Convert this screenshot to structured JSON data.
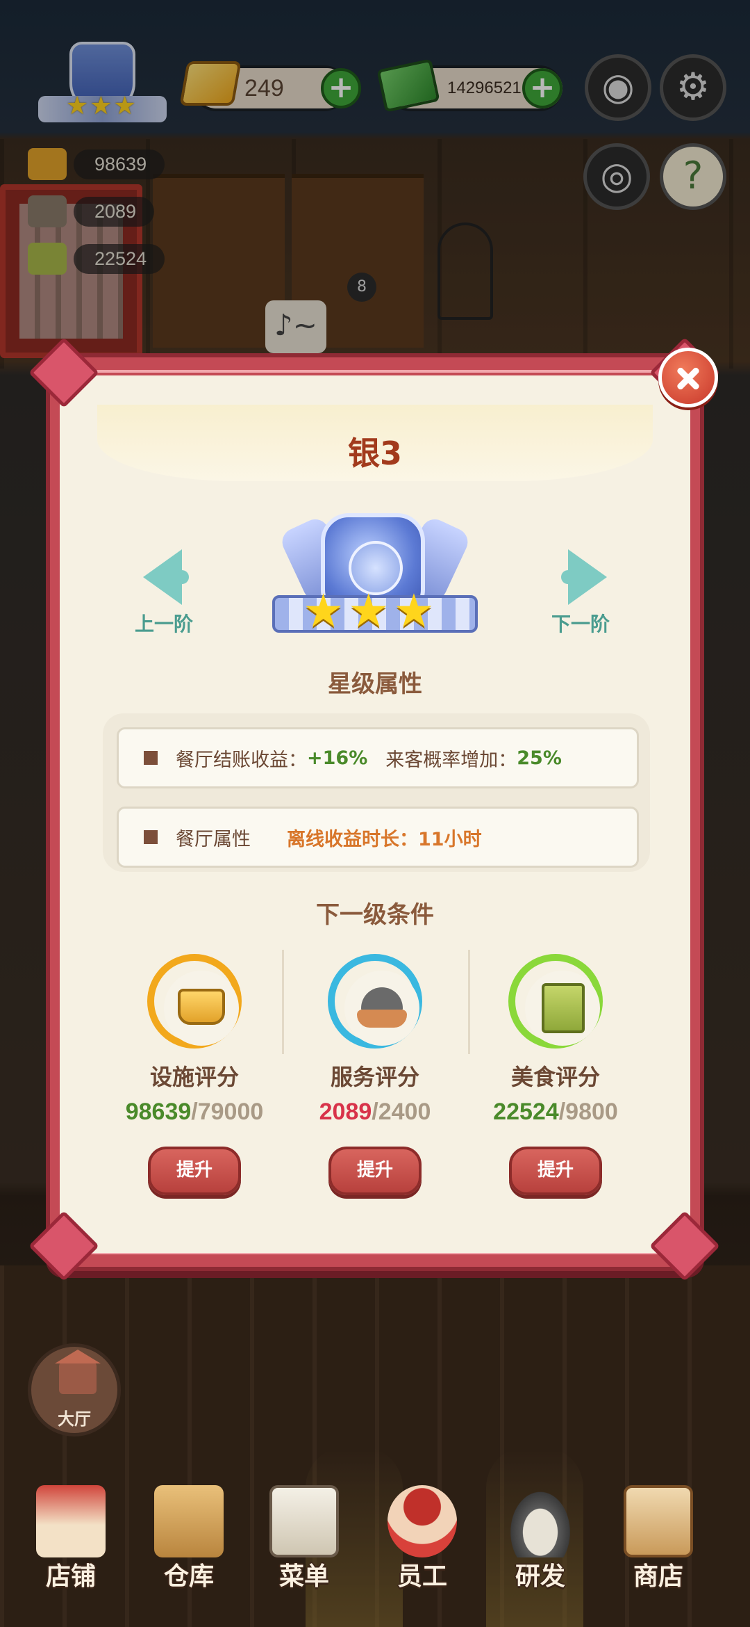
{
  "hud": {
    "rank_stars": "★★★",
    "gold": "249",
    "cash": "14296521",
    "plus": "+",
    "facility_score": "98639",
    "service_score": "2089",
    "food_score": "22524",
    "music_glyph": "♪~",
    "badge_count": "8"
  },
  "modal": {
    "title": "银3",
    "prev_label": "上一阶",
    "next_label": "下一阶",
    "medal_stars": "★★★",
    "attributes_heading": "星级属性",
    "attr1_a_label": "餐厅结账收益：",
    "attr1_a_value": "+16%",
    "attr1_b_label": "来客概率增加：",
    "attr1_b_value": "25%",
    "attr2_label": "餐厅属性",
    "attr2_value": "离线收益时长：11小时",
    "conditions_heading": "下一级条件",
    "conditions": [
      {
        "label": "设施评分",
        "current": "98639",
        "required": "79000",
        "ring_color": "#f2a81c",
        "current_color": "#4a8a2a",
        "button": "提升"
      },
      {
        "label": "服务评分",
        "current": "2089",
        "required": "2400",
        "ring_color": "#3ab8e0",
        "current_color": "#d8334a",
        "button": "提升"
      },
      {
        "label": "美食评分",
        "current": "22524",
        "required": "9800",
        "ring_color": "#8ad83a",
        "current_color": "#4a8a2a",
        "button": "提升"
      }
    ],
    "separator": "/"
  },
  "bottom_nav": {
    "hall": "大厅",
    "items": [
      "店铺",
      "仓库",
      "菜单",
      "员工",
      "研发",
      "商店"
    ]
  },
  "colors": {
    "frame": "#c44a55",
    "paper": "#f6f1e3",
    "title": "#a23a1c",
    "accent_teal": "#7ecbc3",
    "button_red": "#c44a45"
  },
  "icons": [
    "rank-badge-icon",
    "gold-ingot-icon",
    "cash-icon",
    "camera-icon",
    "gear-icon",
    "eye-icon",
    "help-book-icon",
    "close-icon",
    "chevron-left-icon",
    "chevron-right-icon",
    "facility-icon",
    "service-cloche-icon",
    "food-book-icon",
    "hall-house-icon"
  ]
}
